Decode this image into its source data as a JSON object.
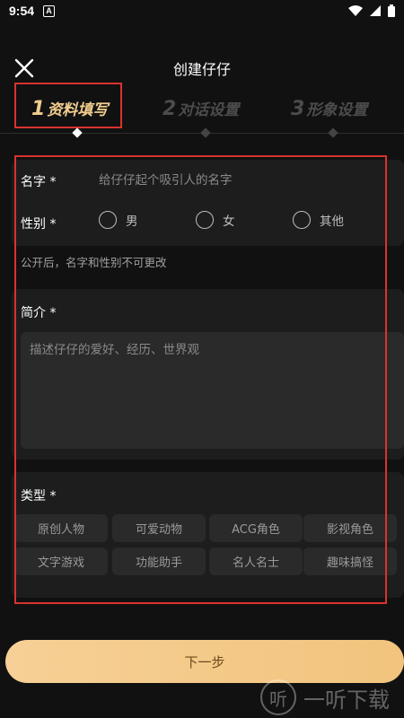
{
  "status_bar": {
    "time": "9:54",
    "a_badge": "A"
  },
  "header": {
    "title": "创建仔仔"
  },
  "steps": [
    {
      "num": "1",
      "label": "资料填写",
      "active": true
    },
    {
      "num": "2",
      "label": "对话设置",
      "active": false
    },
    {
      "num": "3",
      "label": "形象设置",
      "active": false
    }
  ],
  "basic": {
    "name_label": "名字 *",
    "name_placeholder": "给仔仔起个吸引人的名字",
    "gender_label": "性别 *",
    "gender_options": [
      "男",
      "女",
      "其他"
    ],
    "hint": "公开后，名字和性别不可更改"
  },
  "intro": {
    "label": "简介 *",
    "placeholder": "描述仔仔的爱好、经历、世界观"
  },
  "types": {
    "label": "类型 *",
    "tags": [
      "原创人物",
      "可爱动物",
      "ACG角色",
      "影视角色",
      "文字游戏",
      "功能助手",
      "名人名士",
      "趣味搞怪"
    ]
  },
  "next_button": "下一步",
  "watermark": {
    "logo": "听",
    "text": "一听下载"
  },
  "colors": {
    "accent": "#f1cd8e",
    "highlight_border": "#d8332e",
    "button_gradient_start": "#f6d096",
    "button_gradient_end": "#f2c47d"
  }
}
